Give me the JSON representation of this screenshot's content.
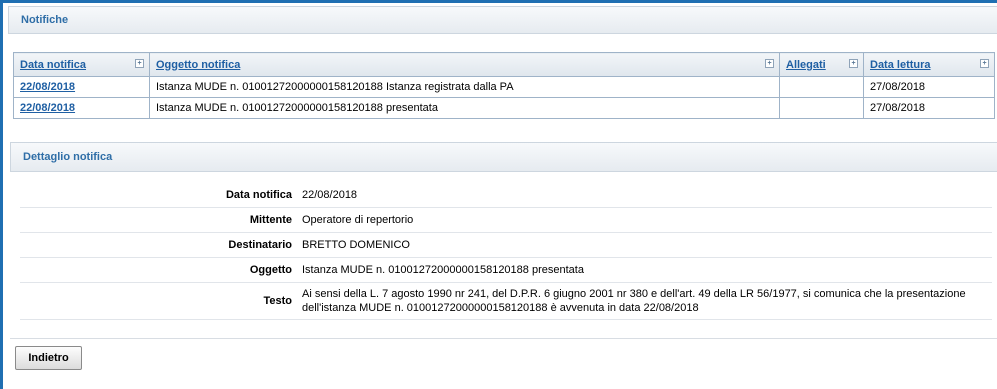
{
  "notifiche": {
    "title": "Notifiche",
    "columns": [
      "Data notifica",
      "Oggetto notifica",
      "Allegati",
      "Data lettura"
    ],
    "rows": [
      {
        "data_notifica": "22/08/2018",
        "oggetto": "Istanza MUDE n. 01001272000000158120188 Istanza registrata dalla PA",
        "allegati": "",
        "data_lettura": "27/08/2018"
      },
      {
        "data_notifica": "22/08/2018",
        "oggetto": "Istanza MUDE n. 01001272000000158120188 presentata",
        "allegati": "",
        "data_lettura": "27/08/2018"
      }
    ]
  },
  "dettaglio": {
    "title": "Dettaglio notifica",
    "fields": [
      {
        "label": "Data notifica",
        "value": "22/08/2018"
      },
      {
        "label": "Mittente",
        "value": "Operatore di repertorio"
      },
      {
        "label": "Destinatario",
        "value": "BRETTO DOMENICO"
      },
      {
        "label": "Oggetto",
        "value": "Istanza MUDE n. 01001272000000158120188 presentata"
      },
      {
        "label": "Testo",
        "value": "Ai sensi della L. 7 agosto 1990 nr 241, del D.P.R. 6 giugno 2001 nr 380 e dell'art. 49 della LR 56/1977, si comunica che la presentazione dell'istanza MUDE n. 01001272000000158120188 è avvenuta in data 22/08/2018"
      }
    ]
  },
  "buttons": {
    "back_label": "Indietro"
  },
  "icons": {
    "sort": "sort-icon"
  },
  "colors": {
    "accent": "#1f6fb2",
    "link": "#1f5fa3",
    "header_text": "#2f6ea7"
  }
}
